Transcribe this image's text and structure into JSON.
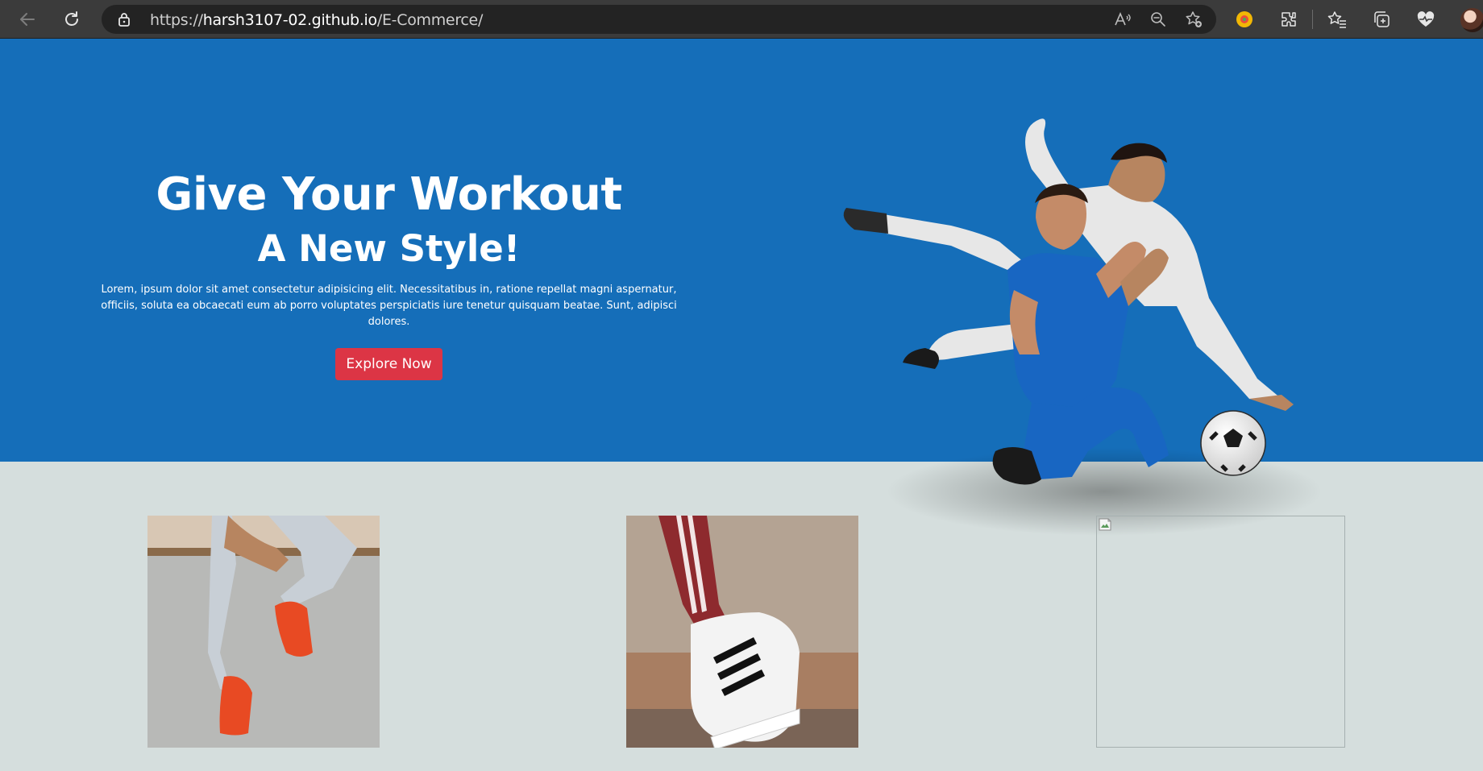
{
  "browser": {
    "url_prefix": "https://",
    "url_host": "harsh3107-02.github.io",
    "url_path": "/E-Commerce/",
    "icons": [
      "back-arrow-icon",
      "refresh-icon",
      "lock-icon",
      "read-aloud-icon",
      "zoom-out-icon",
      "add-favorite-icon",
      "color-extension-icon",
      "extensions-icon",
      "favorites-icon",
      "collections-icon",
      "health-heart-icon",
      "profile-avatar"
    ]
  },
  "hero": {
    "title": "Give Your Workout",
    "subtitle": "A New Style!",
    "description": "Lorem, ipsum dolor sit amet consectetur adipisicing elit. Necessitatibus in, ratione repellat magni aspernatur, officiis, soluta ea obcaecati eum ab porro voluptates perspiciatis iure tenetur quisquam beatae. Sunt, adipisci dolores.",
    "cta_label": "Explore Now",
    "background_color": "#156eb9",
    "cta_color": "#dc3545"
  },
  "products": {
    "background_color": "#d5dedd",
    "items": [
      {
        "image": "red-sneakers-photo"
      },
      {
        "image": "striped-sneaker-photo"
      },
      {
        "image": "broken-image"
      }
    ]
  }
}
